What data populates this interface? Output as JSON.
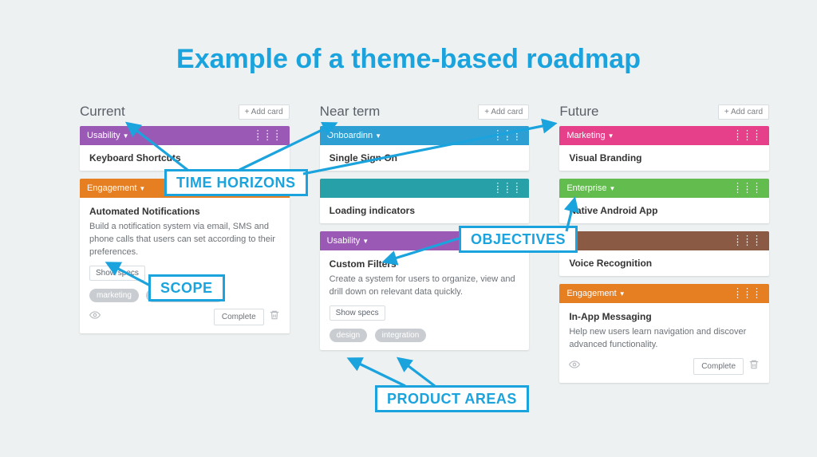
{
  "title": "Example of a theme-based roadmap",
  "add_card": "+ Add card",
  "complete": "Complete",
  "show_specs": "Show specs",
  "columns": [
    {
      "title": "Current"
    },
    {
      "title": "Near term"
    },
    {
      "title": "Future"
    }
  ],
  "col0": {
    "t0": {
      "name": "Usability",
      "card": "Keyboard Shortcuts"
    },
    "t1": {
      "name": "Engagement",
      "card": "Automated Notifications",
      "desc": "Build a notification system via email, SMS and phone calls that users can set according to their preferences.",
      "tags": [
        "marketing",
        "customer success"
      ]
    }
  },
  "col1": {
    "t0": {
      "name": "Onboardinn",
      "card": "Single Sign On"
    },
    "t1": {
      "card": "Loading indicators"
    },
    "t2": {
      "name": "Usability",
      "card": "Custom Filters",
      "desc": "Create a system for users to organize, view and drill down on relevant data quickly.",
      "tags": [
        "design",
        "integration"
      ]
    }
  },
  "col2": {
    "t0": {
      "name": "Marketing",
      "card": "Visual Branding"
    },
    "t1": {
      "name": "Enterprise",
      "card": "Native Android App"
    },
    "t2": {
      "card": "Voice Recognition"
    },
    "t3": {
      "name": "Engagement",
      "card": "In-App Messaging",
      "desc": "Help new users learn navigation and discover advanced functionality."
    }
  },
  "annotations": {
    "time": "TIME HORIZONS",
    "scope": "SCOPE",
    "objectives": "OBJECTIVES",
    "areas": "PRODUCT AREAS"
  }
}
